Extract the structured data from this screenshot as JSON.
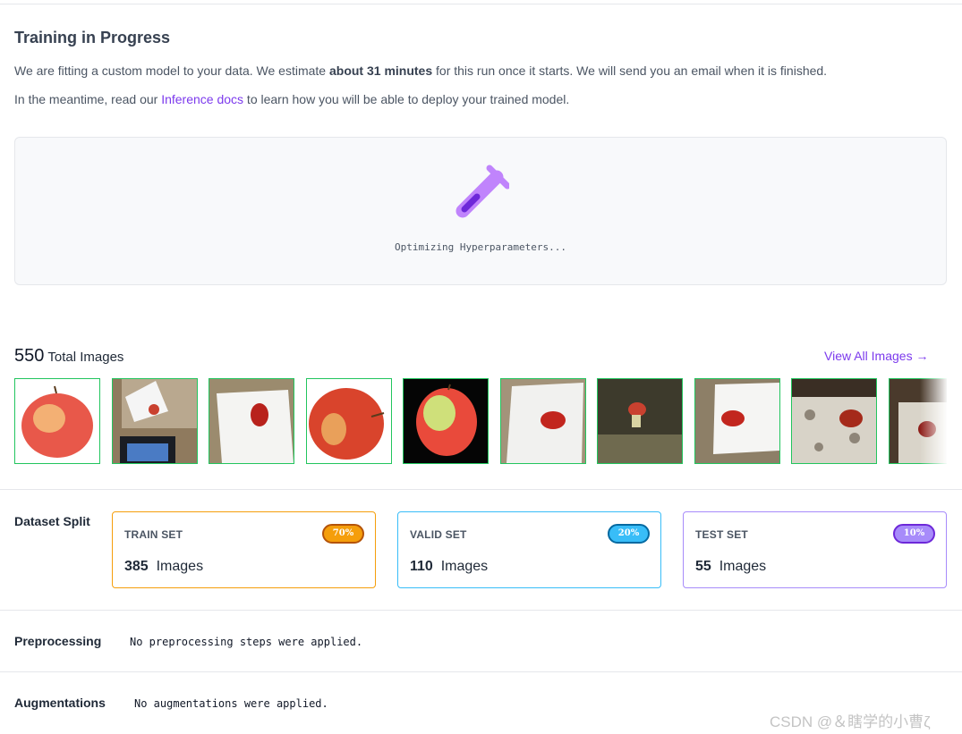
{
  "header": {
    "title": "Training in Progress",
    "desc_prefix": "We are fitting a custom model to your data. We estimate ",
    "desc_bold": "about 31 minutes",
    "desc_suffix": " for this run once it starts. We will send you an email when it is finished.",
    "meantime_prefix": "In the meantime, read our ",
    "inference_link": "Inference docs",
    "meantime_suffix": " to learn how you will be able to deploy your trained model."
  },
  "progress": {
    "status_text": "Optimizing Hyperparameters...",
    "icon": "test-tube-icon"
  },
  "images": {
    "total_count": "550",
    "total_label": "Total Images",
    "view_all": "View All Images",
    "view_all_icon": "arrow-right-icon",
    "thumbnails": [
      "apple-white-background",
      "apple-on-desk-with-monitor",
      "apple-on-paper",
      "apple-closeup",
      "apple-black-background",
      "apple-on-paper-2",
      "apple-core-dark",
      "apple-on-paper-3",
      "apple-on-lace",
      "apple-on-lace-2"
    ]
  },
  "dataset_split": {
    "label": "Dataset Split",
    "unit": "Images",
    "sets": [
      {
        "name": "TRAIN SET",
        "count": "385",
        "badge": "70%",
        "color": "#f59e0b"
      },
      {
        "name": "VALID SET",
        "count": "110",
        "badge": "20%",
        "color": "#38bdf8"
      },
      {
        "name": "TEST SET",
        "count": "55",
        "badge": "10%",
        "color": "#a78bfa"
      }
    ]
  },
  "preprocessing": {
    "label": "Preprocessing",
    "text": "No preprocessing steps were applied."
  },
  "augmentations": {
    "label": "Augmentations",
    "text": "No augmentations were applied."
  },
  "watermark": "CSDN @＆瞎学的小曹ζ",
  "colors": {
    "accent": "#7c3aed",
    "thumb_border": "#22c55e"
  }
}
